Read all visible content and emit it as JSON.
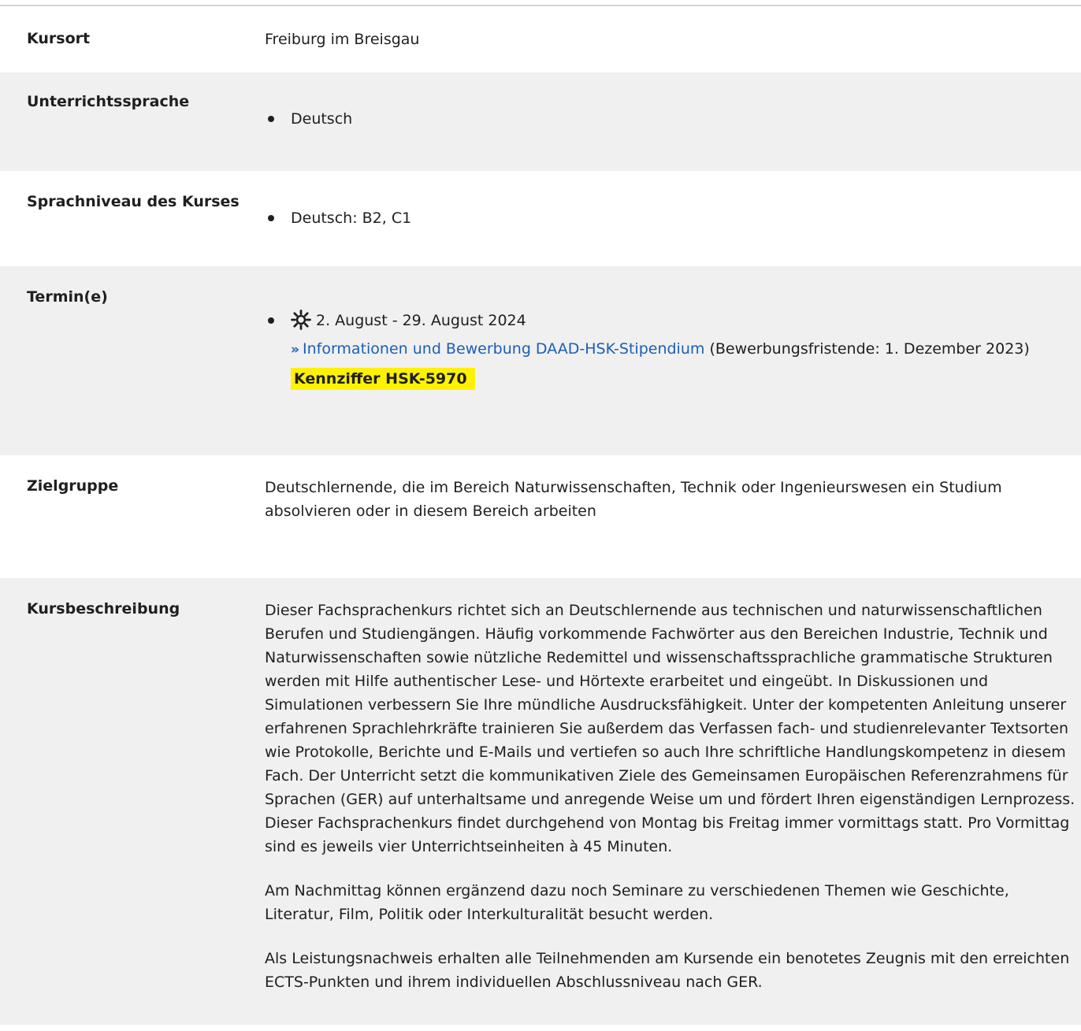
{
  "rows": {
    "kursort": {
      "label": "Kursort",
      "value": "Freiburg im Breisgau"
    },
    "unterrichtssprache": {
      "label": "Unterrichtssprache",
      "items": [
        "Deutsch"
      ]
    },
    "sprachniveau": {
      "label": "Sprachniveau des Kurses",
      "items": [
        "Deutsch: B2, C1"
      ]
    },
    "termine": {
      "label": "Termin(e)",
      "icon": "sun-icon",
      "date": "2. August - 29. August 2024",
      "link_arrow": "»",
      "link_text": "Informationen und Bewerbung DAAD-HSK-Stipendium",
      "deadline": "(Bewerbungsfristende: 1. Dezember 2023)",
      "kennziffer": "Kennziffer HSK-5970",
      "highlight_color": "#fff200"
    },
    "zielgruppe": {
      "label": "Zielgruppe",
      "value": "Deutschlernende, die im Bereich Naturwissenschaften, Technik oder Ingenieurswesen ein Studium absolvieren oder in diesem Bereich arbeiten"
    },
    "kursbeschreibung": {
      "label": "Kursbeschreibung",
      "paragraphs": [
        "Dieser Fachsprachenkurs richtet sich an Deutschlernende aus technischen und naturwissenschaftlichen Berufen und Studiengängen. Häufig vorkommende Fachwörter aus den Bereichen Industrie, Technik und Naturwissenschaften sowie nützliche Redemittel und wissenschaftssprachliche grammatische Strukturen werden mit Hilfe authentischer Lese- und Hörtexte erarbeitet und eingeübt. In Diskussionen und Simulationen verbessern Sie Ihre mündliche Ausdrucksfähigkeit. Unter der kompetenten Anleitung unserer erfahrenen Sprachlehrkräfte trainieren Sie außerdem das Verfassen fach- und studienrelevanter Textsorten wie Protokolle, Berichte und E-Mails und vertiefen so auch Ihre schriftliche Handlungskompetenz in diesem Fach. Der Unterricht setzt die kommunikativen Ziele des Gemeinsamen Europäischen Referenzrahmens für Sprachen (GER) auf unterhaltsame und anregende Weise um und fördert Ihren eigenständigen Lernprozess. Dieser Fachsprachenkurs findet durchgehend von Montag bis Freitag immer vormittags statt. Pro Vormittag sind es jeweils vier Unterrichtseinheiten à 45 Minuten.",
        "Am Nachmittag können ergänzend dazu noch Seminare zu verschiedenen Themen wie Geschichte, Literatur, Film, Politik oder Interkulturalität besucht werden.",
        "Als Leistungsnachweis erhalten alle Teilnehmenden am Kursende ein benotetes Zeugnis mit den erreichten ECTS-Punkten und ihrem individuellen Abschlussniveau nach GER."
      ]
    }
  },
  "colors": {
    "row_alt": "#f0f0f0",
    "link": "#1a5fb4"
  }
}
